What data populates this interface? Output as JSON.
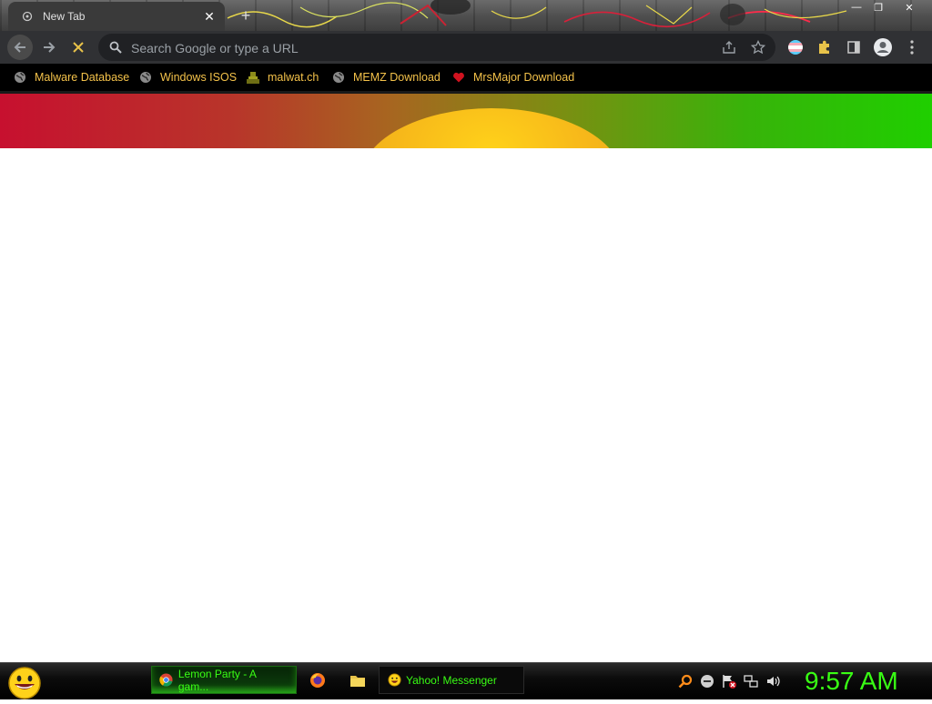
{
  "browser": {
    "tab": {
      "title": "New Tab",
      "close_symbol": "✕",
      "favicon": "new-tab-icon"
    },
    "new_tab_symbol": "+",
    "window_controls": {
      "minimize": "—",
      "maximize": "❐",
      "close": "✕"
    },
    "omnibox": {
      "placeholder": "Search Google or type a URL",
      "value": ""
    },
    "toolbar_icons": [
      "back-arrow-icon",
      "forward-arrow-icon",
      "stop-loading-icon",
      "share-icon",
      "star-icon",
      "profile-flag-icon",
      "extensions-puzzle-icon",
      "side-panel-icon",
      "account-avatar-icon"
    ]
  },
  "bookmarks": [
    {
      "label": "Malware Database",
      "icon": "globe-icon"
    },
    {
      "label": "Windows ISOS",
      "icon": "globe-icon"
    },
    {
      "label": "malwat.ch",
      "icon": "malwatch-favicon-icon"
    },
    {
      "label": "MEMZ Download",
      "icon": "globe-icon"
    },
    {
      "label": "MrsMajor Download",
      "icon": "heart-icon"
    }
  ],
  "taskbar": {
    "tasks": [
      {
        "label": "Lemon Party - A gam...",
        "icon": "chrome-icon",
        "active": true
      },
      {
        "label": "Yahoo! Messenger",
        "icon": "yahoo-smiley-icon",
        "active": false
      }
    ],
    "quick_launch": [
      "firefox-icon",
      "folder-icon"
    ],
    "tray_icons": [
      "search-magnifier-icon",
      "status-dot-icon",
      "action-center-flag-icon",
      "network-icon",
      "volume-icon"
    ],
    "clock": "9:57 AM"
  },
  "colors": {
    "bookmark_text": "#f4c24a",
    "clock_green": "#39ff14",
    "toolbar_bg": "#303134",
    "omnibox_bg": "#202124"
  }
}
